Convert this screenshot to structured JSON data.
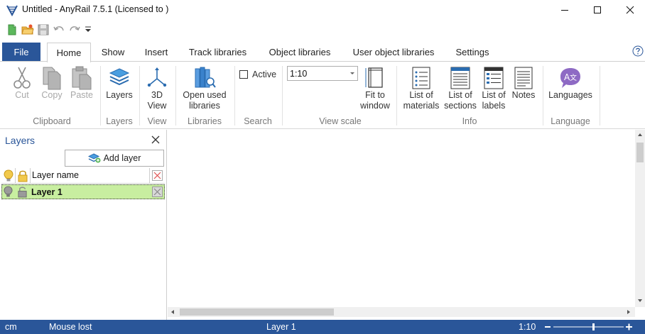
{
  "window": {
    "title": "Untitled - AnyRail 7.5.1 (Licensed to )"
  },
  "tabs": [
    {
      "label": "File"
    },
    {
      "label": "Home"
    },
    {
      "label": "Show"
    },
    {
      "label": "Insert"
    },
    {
      "label": "Track libraries"
    },
    {
      "label": "Object libraries"
    },
    {
      "label": "User object libraries"
    },
    {
      "label": "Settings"
    }
  ],
  "ribbon": {
    "clipboard": {
      "group": "Clipboard",
      "cut": "Cut",
      "copy": "Copy",
      "paste": "Paste"
    },
    "layers": {
      "group": "Layers",
      "layers": "Layers"
    },
    "view": {
      "group": "View",
      "view3d_line1": "3D",
      "view3d_line2": "View"
    },
    "libraries": {
      "group": "Libraries",
      "open_line1": "Open used",
      "open_line2": "libraries"
    },
    "search": {
      "group": "Search",
      "active": "Active"
    },
    "view_scale": {
      "group": "View scale",
      "scale_value": "1:10",
      "fit_line1": "Fit to",
      "fit_line2": "window"
    },
    "info": {
      "group": "Info",
      "materials_line1": "List of",
      "materials_line2": "materials",
      "sections_line1": "List of",
      "sections_line2": "sections",
      "labels_line1": "List of",
      "labels_line2": "labels",
      "notes": "Notes"
    },
    "language": {
      "group": "Language",
      "languages": "Languages"
    }
  },
  "layers_panel": {
    "title": "Layers",
    "add_layer": "Add layer",
    "column_name": "Layer name",
    "rows": [
      {
        "name": "Layer 1"
      }
    ]
  },
  "statusbar": {
    "unit": "cm",
    "mouse": "Mouse lost",
    "layer": "Layer 1",
    "scale": "1:10"
  },
  "colors": {
    "accent": "#2a5699",
    "layer_row_bg": "#c8eea0"
  }
}
